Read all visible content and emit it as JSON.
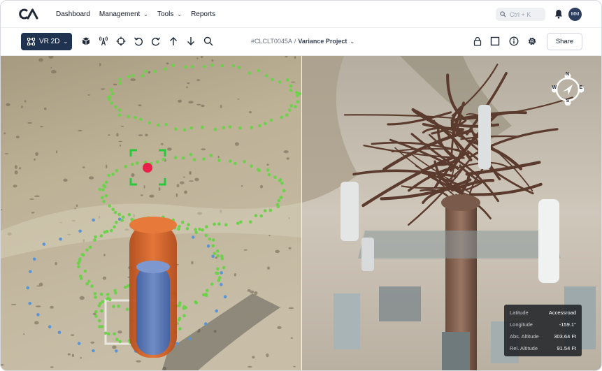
{
  "brand": {
    "logo_text": "CA"
  },
  "nav": {
    "items": [
      {
        "label": "Dashboard",
        "has_dropdown": false
      },
      {
        "label": "Management",
        "has_dropdown": true
      },
      {
        "label": "Tools",
        "has_dropdown": true
      },
      {
        "label": "Reports",
        "has_dropdown": false
      }
    ]
  },
  "search": {
    "placeholder": "Ctrl + K"
  },
  "user": {
    "initials": "MM"
  },
  "toolbar": {
    "mode_label": "VR 2D",
    "tools": [
      "cube-icon",
      "antenna-icon",
      "crosshair-icon",
      "undo-icon",
      "redo-icon",
      "arrow-up-icon",
      "arrow-down-icon",
      "search-icon"
    ],
    "breadcrumb": {
      "id": "#CLCLT0045A",
      "separator": "/",
      "project": "Variance Project"
    },
    "right_tools": [
      "lock-icon",
      "square-icon",
      "info-icon",
      "settings-icon"
    ],
    "share_label": "Share"
  },
  "compass": {
    "n": "N",
    "e": "E",
    "s": "S",
    "w": "W"
  },
  "location": {
    "rows": [
      {
        "label": "Latitude",
        "value": "Accessroad"
      },
      {
        "label": "Longitude",
        "value": "-159.1°"
      },
      {
        "label": "Abs. Altitude",
        "value": "303.64 Ft"
      },
      {
        "label": "Rel. Altitude",
        "value": "91.54 Ft"
      }
    ]
  },
  "colors": {
    "nav_dark": "#1f3250",
    "pole_orange": "#d9642a",
    "pole_blue": "#5a79b5",
    "point_green": "#6dd14c",
    "point_blue": "#5b95d6",
    "target_red": "#e8204a",
    "target_green": "#27c83a"
  }
}
